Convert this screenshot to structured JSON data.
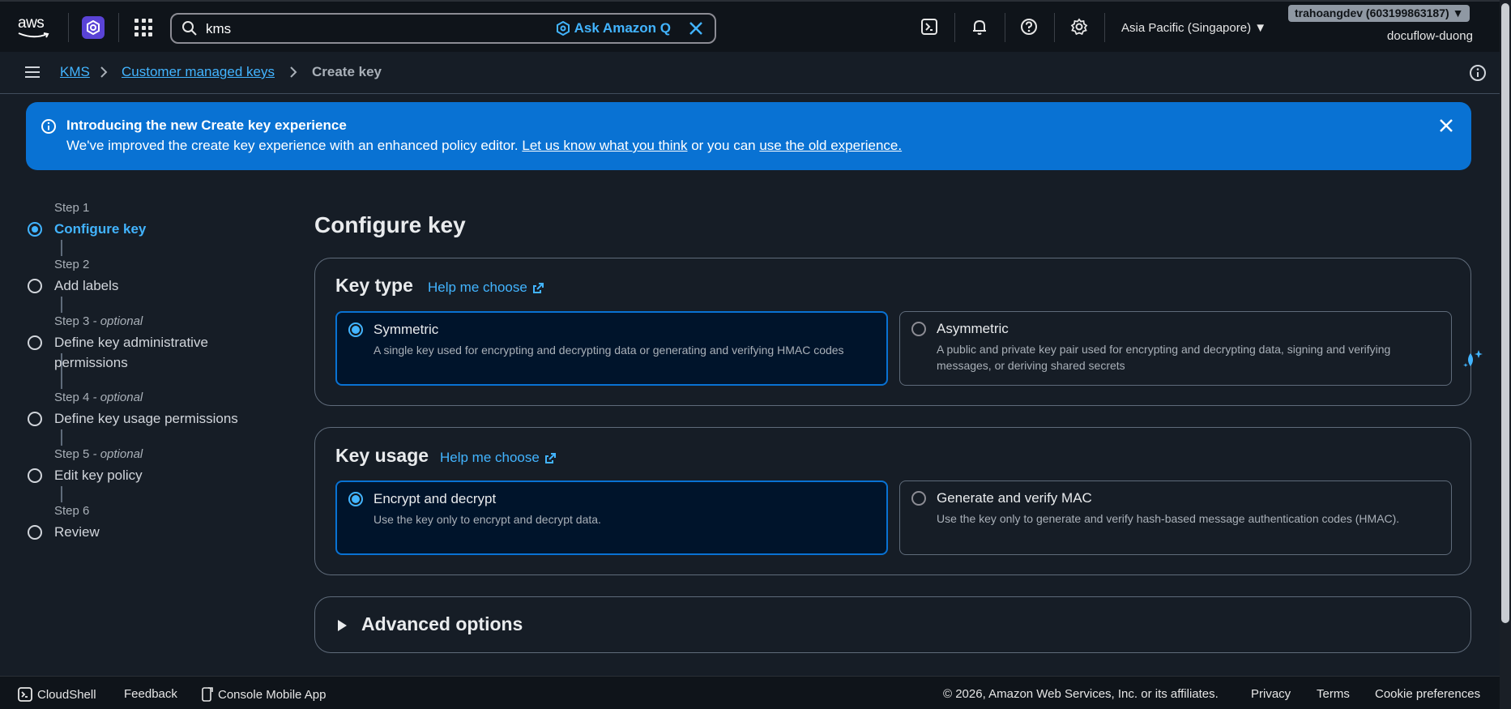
{
  "topbar": {
    "logo_text": "aws",
    "search": {
      "value": "kms",
      "ask_label": "Ask Amazon Q"
    },
    "region": "Asia Pacific (Singapore)",
    "account": "trahoangdev (603199863187)",
    "account_sub": "docuflow-duong"
  },
  "breadcrumb": {
    "items": [
      {
        "label": "KMS"
      },
      {
        "label": "Customer managed keys"
      },
      {
        "label": "Create key"
      }
    ]
  },
  "flash": {
    "title": "Introducing the new Create key experience",
    "body_prefix": "We've improved the create key experience with an enhanced policy editor. ",
    "link1": "Let us know what you think",
    "body_mid": " or you can ",
    "link2": "use the old experience."
  },
  "steps": [
    {
      "num": "Step 1",
      "optional": "",
      "label": "Configure key",
      "active": true
    },
    {
      "num": "Step 2",
      "optional": "",
      "label": "Add labels",
      "active": false
    },
    {
      "num": "Step 3",
      "optional": " - optional",
      "label": "Define key administrative permissions",
      "active": false
    },
    {
      "num": "Step 4",
      "optional": " - optional",
      "label": "Define key usage permissions",
      "active": false
    },
    {
      "num": "Step 5",
      "optional": " - optional",
      "label": "Edit key policy",
      "active": false
    },
    {
      "num": "Step 6",
      "optional": "",
      "label": "Review",
      "active": false
    }
  ],
  "main": {
    "title": "Configure key",
    "key_type": {
      "heading": "Key type",
      "help": "Help me choose",
      "options": [
        {
          "title": "Symmetric",
          "desc": "A single key used for encrypting and decrypting data or generating and verifying HMAC codes",
          "selected": true
        },
        {
          "title": "Asymmetric",
          "desc": "A public and private key pair used for encrypting and decrypting data, signing and verifying messages, or deriving shared secrets",
          "selected": false
        }
      ]
    },
    "key_usage": {
      "heading": "Key usage",
      "help": "Help me choose",
      "options": [
        {
          "title": "Encrypt and decrypt",
          "desc": "Use the key only to encrypt and decrypt data.",
          "selected": true
        },
        {
          "title": "Generate and verify MAC",
          "desc": "Use the key only to generate and verify hash-based message authentication codes (HMAC).",
          "selected": false
        }
      ]
    },
    "advanced_label": "Advanced options"
  },
  "footer": {
    "cloudshell": "CloudShell",
    "feedback": "Feedback",
    "mobile": "Console Mobile App",
    "copyright": "© 2026, Amazon Web Services, Inc. or its affiliates.",
    "privacy": "Privacy",
    "terms": "Terms",
    "cookies": "Cookie preferences"
  },
  "colors": {
    "accent": "#42b4ff",
    "flash_bg": "#0972d3",
    "selected_bg": "#00142b",
    "page_bg": "#161d26"
  }
}
